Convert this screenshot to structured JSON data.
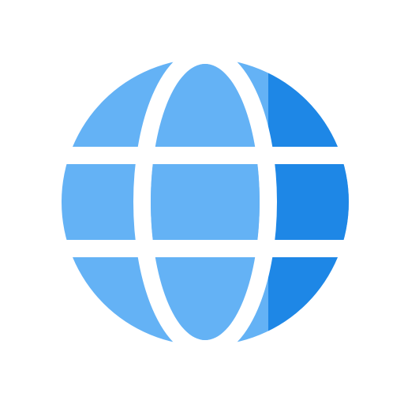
{
  "icon": {
    "name": "globe-icon",
    "colors": {
      "light": "#64B2F5",
      "dark": "#1E87E6",
      "background": "#FFFFFF",
      "gap": "#FFFFFF"
    }
  }
}
